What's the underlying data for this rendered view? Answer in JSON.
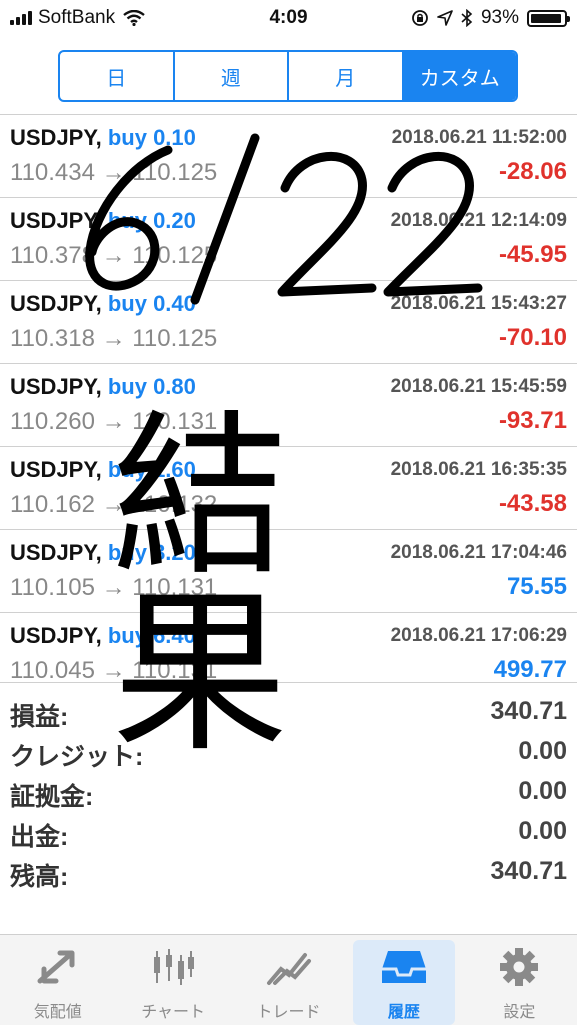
{
  "status_bar": {
    "carrier": "SoftBank",
    "time": "4:09",
    "battery": "93%",
    "battery_level": 0.93
  },
  "period_tabs": [
    {
      "label": "日",
      "active": false
    },
    {
      "label": "週",
      "active": false
    },
    {
      "label": "月",
      "active": false
    },
    {
      "label": "カスタム",
      "active": true
    }
  ],
  "trades": [
    {
      "symbol": "USDJPY,",
      "side": "buy 0.10",
      "time": "2018.06.21 11:52:00",
      "prices": "110.434 → 110.125",
      "pl": "-28.06",
      "positive": false
    },
    {
      "symbol": "USDJPY,",
      "side": "buy 0.20",
      "time": "2018.06.21 12:14:09",
      "prices": "110.378 → 110.125",
      "pl": "-45.95",
      "positive": false
    },
    {
      "symbol": "USDJPY,",
      "side": "buy 0.40",
      "time": "2018.06.21 15:43:27",
      "prices": "110.318 → 110.125",
      "pl": "-70.10",
      "positive": false
    },
    {
      "symbol": "USDJPY,",
      "side": "buy 0.80",
      "time": "2018.06.21 15:45:59",
      "prices": "110.260 → 110.131",
      "pl": "-93.71",
      "positive": false
    },
    {
      "symbol": "USDJPY,",
      "side": "buy 1.60",
      "time": "2018.06.21 16:35:35",
      "prices": "110.162 → 110.132",
      "pl": "-43.58",
      "positive": false
    },
    {
      "symbol": "USDJPY,",
      "side": "buy 3.20",
      "time": "2018.06.21 17:04:46",
      "prices": "110.105 → 110.131",
      "pl": "75.55",
      "positive": true
    },
    {
      "symbol": "USDJPY,",
      "side": "buy 6.40",
      "time": "2018.06.21 17:06:29",
      "prices": "110.045 → 110.131",
      "pl": "499.77",
      "positive": true
    }
  ],
  "summary": [
    {
      "label": "損益:",
      "value": "340.71"
    },
    {
      "label": "クレジット:",
      "value": "0.00"
    },
    {
      "label": "証拠金:",
      "value": "0.00"
    },
    {
      "label": "出金:",
      "value": "0.00"
    },
    {
      "label": "残高:",
      "value": "340.71"
    }
  ],
  "overlay": {
    "date_text": "6/22",
    "result_text": "結果"
  },
  "tab_bar": [
    {
      "label": "気配値",
      "icon": "quotes-arrows-icon",
      "active": false
    },
    {
      "label": "チャート",
      "icon": "candlestick-chart-icon",
      "active": false
    },
    {
      "label": "トレード",
      "icon": "trade-chart-icon",
      "active": false
    },
    {
      "label": "履歴",
      "icon": "history-inbox-icon",
      "active": true
    },
    {
      "label": "設定",
      "icon": "gear-icon",
      "active": false
    }
  ],
  "colors": {
    "accent": "#1a84f0",
    "negative": "#e0322c",
    "positive": "#1a84f0"
  }
}
